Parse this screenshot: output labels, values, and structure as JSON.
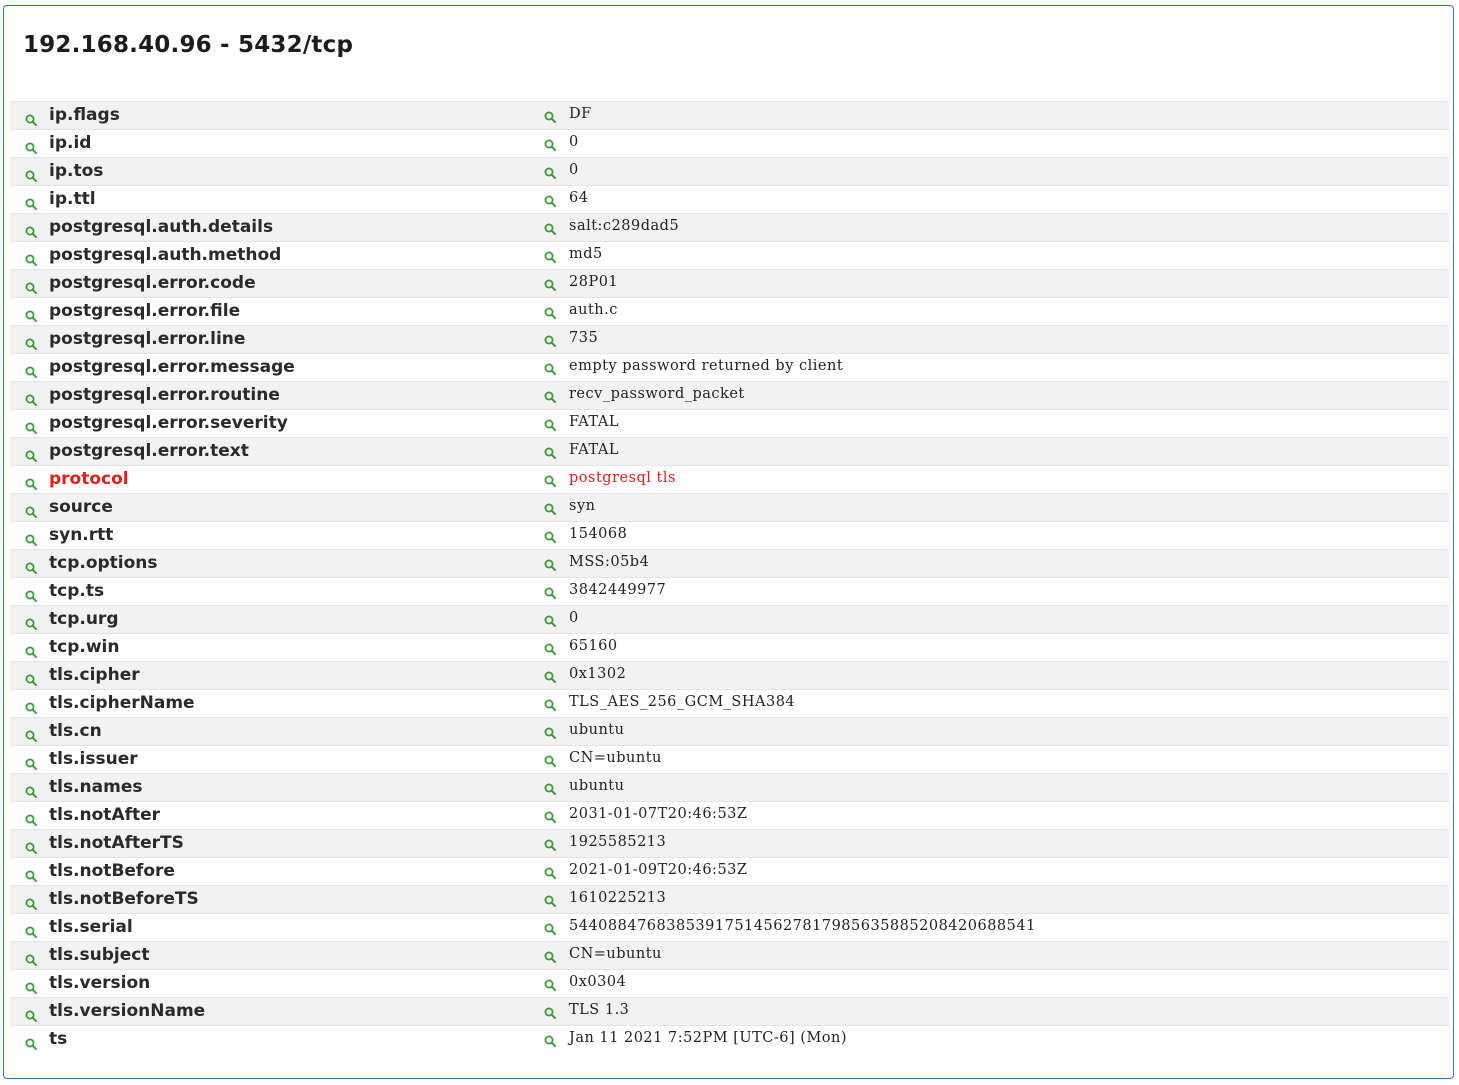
{
  "header": {
    "title": "192.168.40.96 - 5432/tcp"
  },
  "colors": {
    "icon_green": "#3d9a3d",
    "highlight_red": "#e0201f",
    "border_blue": "#3b73b9"
  },
  "icons": {
    "key": "search-icon",
    "value": "search-icon"
  },
  "fields": [
    {
      "key": "ip.flags",
      "value": "DF"
    },
    {
      "key": "ip.id",
      "value": "0"
    },
    {
      "key": "ip.tos",
      "value": "0"
    },
    {
      "key": "ip.ttl",
      "value": "64"
    },
    {
      "key": "postgresql.auth.details",
      "value": "salt:c289dad5"
    },
    {
      "key": "postgresql.auth.method",
      "value": "md5"
    },
    {
      "key": "postgresql.error.code",
      "value": "28P01"
    },
    {
      "key": "postgresql.error.file",
      "value": "auth.c"
    },
    {
      "key": "postgresql.error.line",
      "value": "735"
    },
    {
      "key": "postgresql.error.message",
      "value": "empty password returned by client"
    },
    {
      "key": "postgresql.error.routine",
      "value": "recv_password_packet"
    },
    {
      "key": "postgresql.error.severity",
      "value": "FATAL"
    },
    {
      "key": "postgresql.error.text",
      "value": "FATAL"
    },
    {
      "key": "protocol",
      "value": "postgresql tls",
      "highlight": true
    },
    {
      "key": "source",
      "value": "syn"
    },
    {
      "key": "syn.rtt",
      "value": "154068"
    },
    {
      "key": "tcp.options",
      "value": "MSS:05b4"
    },
    {
      "key": "tcp.ts",
      "value": "3842449977"
    },
    {
      "key": "tcp.urg",
      "value": "0"
    },
    {
      "key": "tcp.win",
      "value": "65160"
    },
    {
      "key": "tls.cipher",
      "value": "0x1302"
    },
    {
      "key": "tls.cipherName",
      "value": "TLS_AES_256_GCM_SHA384"
    },
    {
      "key": "tls.cn",
      "value": "ubuntu"
    },
    {
      "key": "tls.issuer",
      "value": "CN=ubuntu"
    },
    {
      "key": "tls.names",
      "value": "ubuntu"
    },
    {
      "key": "tls.notAfter",
      "value": "2031-01-07T20:46:53Z"
    },
    {
      "key": "tls.notAfterTS",
      "value": "1925585213"
    },
    {
      "key": "tls.notBefore",
      "value": "2021-01-09T20:46:53Z"
    },
    {
      "key": "tls.notBeforeTS",
      "value": "1610225213"
    },
    {
      "key": "tls.serial",
      "value": "544088476838539175145627817985635885208420688541"
    },
    {
      "key": "tls.subject",
      "value": "CN=ubuntu"
    },
    {
      "key": "tls.version",
      "value": "0x0304"
    },
    {
      "key": "tls.versionName",
      "value": "TLS 1.3"
    },
    {
      "key": "ts",
      "value": "Jan 11 2021 7:52PM [UTC-6] (Mon)"
    }
  ]
}
